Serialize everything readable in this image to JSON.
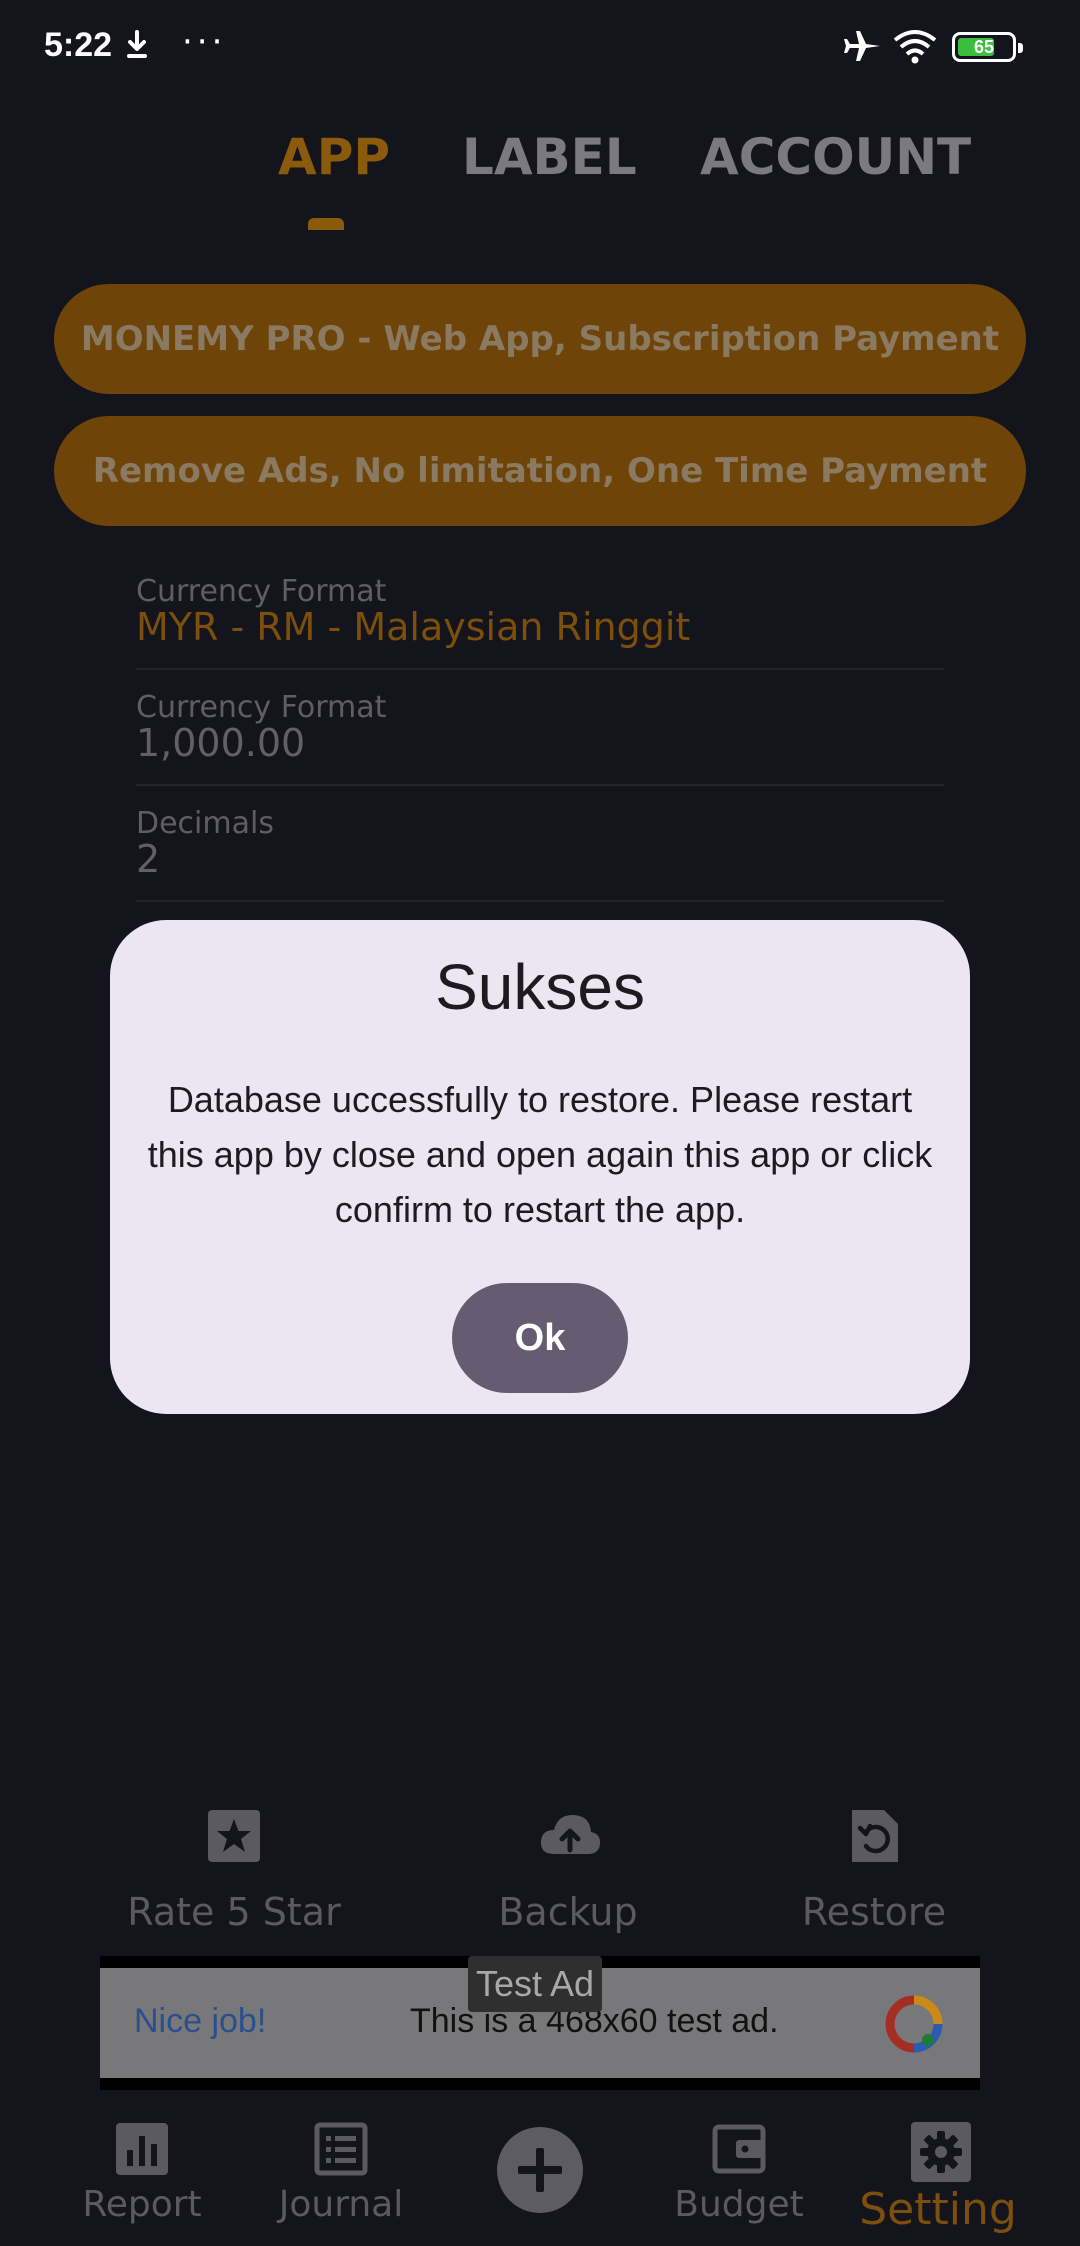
{
  "status_bar": {
    "time": "5:22",
    "battery": "65",
    "more": "···"
  },
  "tabs": [
    {
      "label": "APP",
      "active": true
    },
    {
      "label": "LABEL",
      "active": false
    },
    {
      "label": "ACCOUNT",
      "active": false
    }
  ],
  "promo": {
    "pro_label": "MONEMY PRO - Web App, Subscription Payment",
    "remove_ads_label": "Remove Ads, No limitation, One Time Payment"
  },
  "settings": [
    {
      "label": "Currency Format",
      "value": "MYR - RM - Malaysian Ringgit"
    },
    {
      "label": "Currency Format",
      "value": "1,000.00"
    },
    {
      "label": "Decimals",
      "value": "2"
    }
  ],
  "actions": [
    {
      "label": "Rate 5 Star",
      "icon": "star-icon"
    },
    {
      "label": "Backup",
      "icon": "cloud-upload-icon"
    },
    {
      "label": "Restore",
      "icon": "restore-icon"
    }
  ],
  "ad": {
    "tag": "Test Ad",
    "headline": "Nice job!",
    "message": "This is a 468x60 test ad."
  },
  "nav": [
    {
      "label": "Report",
      "icon": "bar-chart-icon"
    },
    {
      "label": "Journal",
      "icon": "list-icon"
    },
    {
      "label": "",
      "icon": "add-icon"
    },
    {
      "label": "Budget",
      "icon": "wallet-icon"
    },
    {
      "label": "Setting",
      "icon": "gear-icon",
      "active": true
    }
  ],
  "dialog": {
    "title": "Sukses",
    "message": "Database uccessfully to restore. Please restart this app by close and open again this app or click confirm to restart the app.",
    "ok_label": "Ok"
  },
  "colors": {
    "background": "#13141c",
    "accent_dimmed": "#8b5a0a",
    "dialog_surface": "#ece6f2",
    "dialog_button": "#655c72"
  }
}
